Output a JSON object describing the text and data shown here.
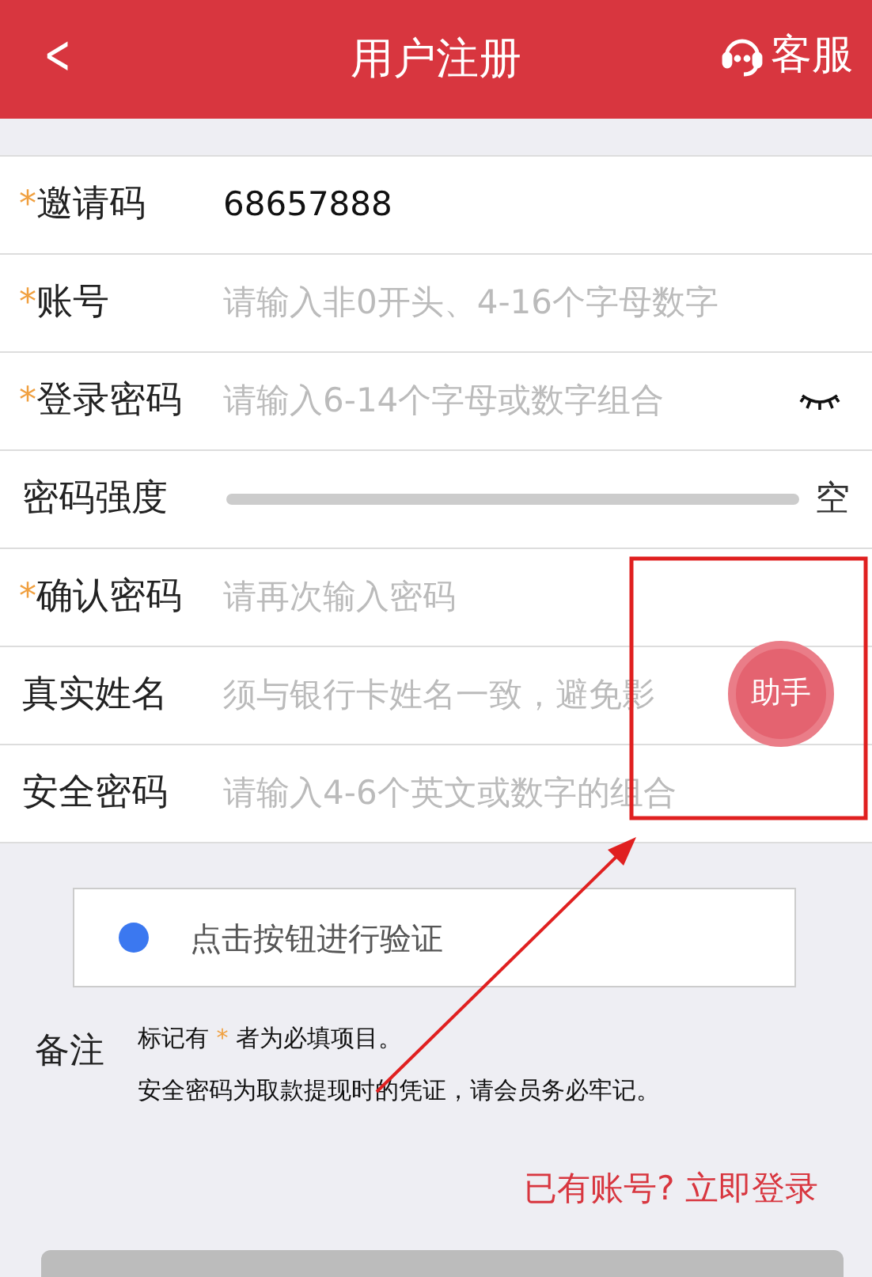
{
  "header": {
    "back": "<",
    "title": "用户注册",
    "service": "客服"
  },
  "form": {
    "rows": [
      {
        "kind": "input",
        "required_mark": "*",
        "label": "邀请码",
        "value": "68657888"
      },
      {
        "kind": "input",
        "required_mark": "*",
        "label": "账号",
        "placeholder": "请输入非0开头、4-16个字母数字"
      },
      {
        "kind": "password",
        "required_mark": "*",
        "label": "登录密码",
        "placeholder": "请输入6-14个字母或数字组合"
      },
      {
        "kind": "strength",
        "label": "密码强度",
        "level": 0,
        "reading": "空"
      },
      {
        "kind": "input",
        "required_mark": "*",
        "label": "确认密码",
        "placeholder": "请再次输入密码"
      },
      {
        "kind": "input",
        "label": "真实姓名",
        "placeholder": "须与银行卡姓名一致，避免影"
      },
      {
        "kind": "input",
        "label": "安全密码",
        "placeholder": "请输入4-6个英文或数字的组合"
      }
    ]
  },
  "helper_button": "助手",
  "verify": {
    "label": "点击按钮进行验证"
  },
  "notes": {
    "title": "备注",
    "marked_line": [
      "标记有 ",
      "*",
      " 者为必填项目。"
    ],
    "line": "安全密码为取款提现时的凭证，请会员务必牢记。"
  },
  "login_link": "已有账号? 立即登录"
}
